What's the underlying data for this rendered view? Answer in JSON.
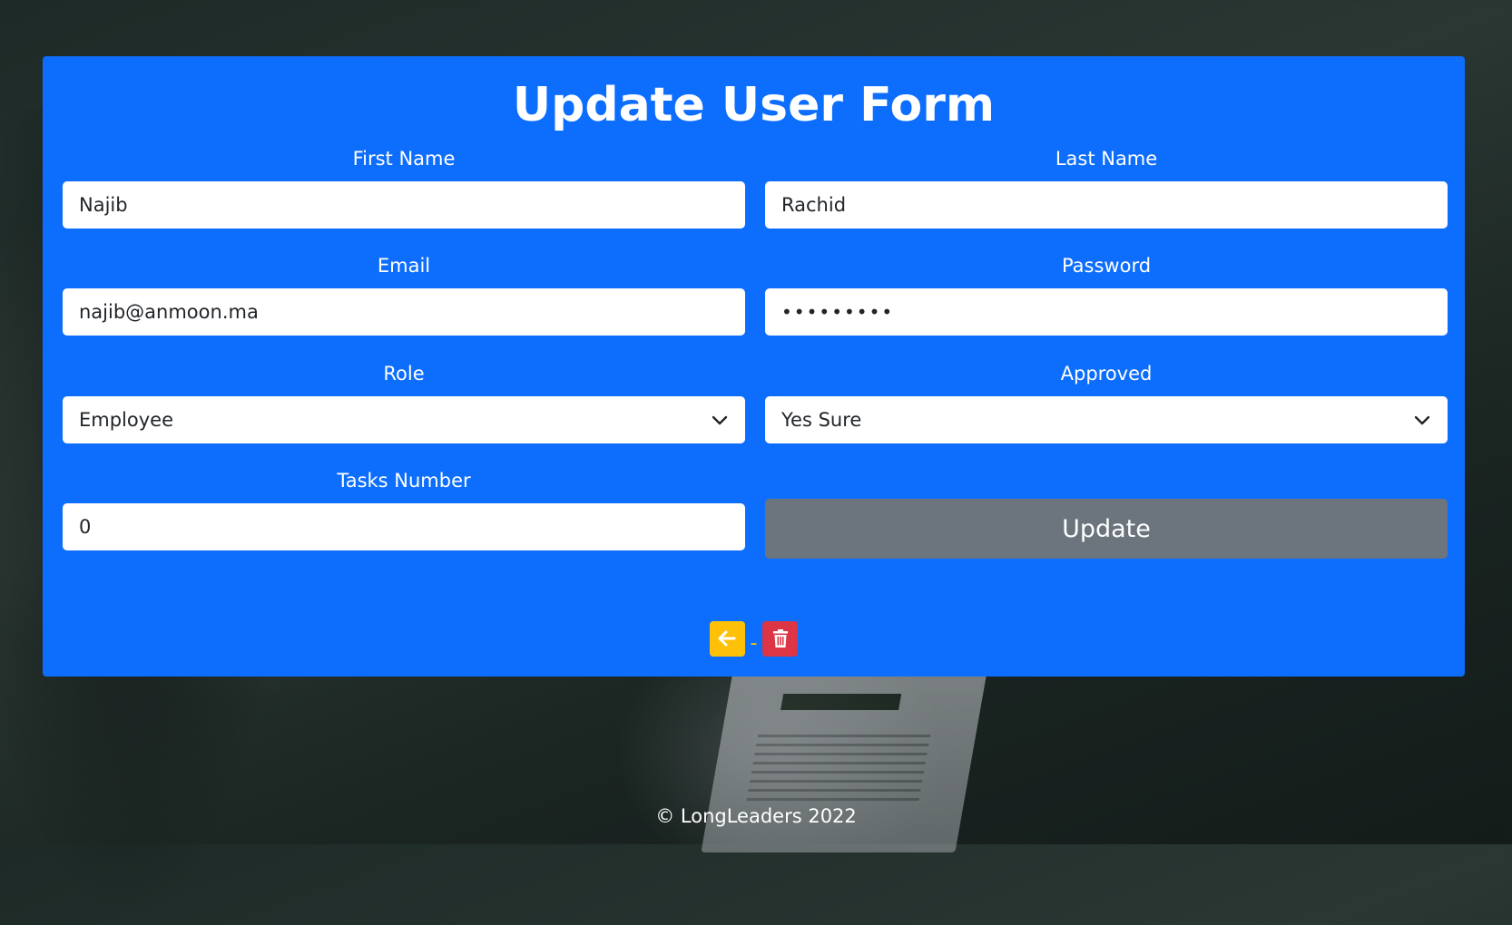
{
  "form": {
    "title": "Update User Form",
    "first_name": {
      "label": "First Name",
      "value": "Najib"
    },
    "last_name": {
      "label": "Last Name",
      "value": "Rachid"
    },
    "email": {
      "label": "Email",
      "value": "najib@anmoon.ma"
    },
    "password": {
      "label": "Password",
      "value": "•••••••••"
    },
    "role": {
      "label": "Role",
      "selected": "Employee"
    },
    "approved": {
      "label": "Approved",
      "selected": "Yes Sure"
    },
    "tasks_number": {
      "label": "Tasks Number",
      "value": "0"
    },
    "update_label": "Update"
  },
  "actions": {
    "back_icon": "arrow-left-icon",
    "separator": "-",
    "delete_icon": "trash-icon"
  },
  "footer": {
    "text": "© LongLeaders 2022"
  },
  "colors": {
    "card": "#0d6efd",
    "update_button": "#6c757d",
    "back_button": "#ffc107",
    "delete_button": "#dc3545"
  }
}
